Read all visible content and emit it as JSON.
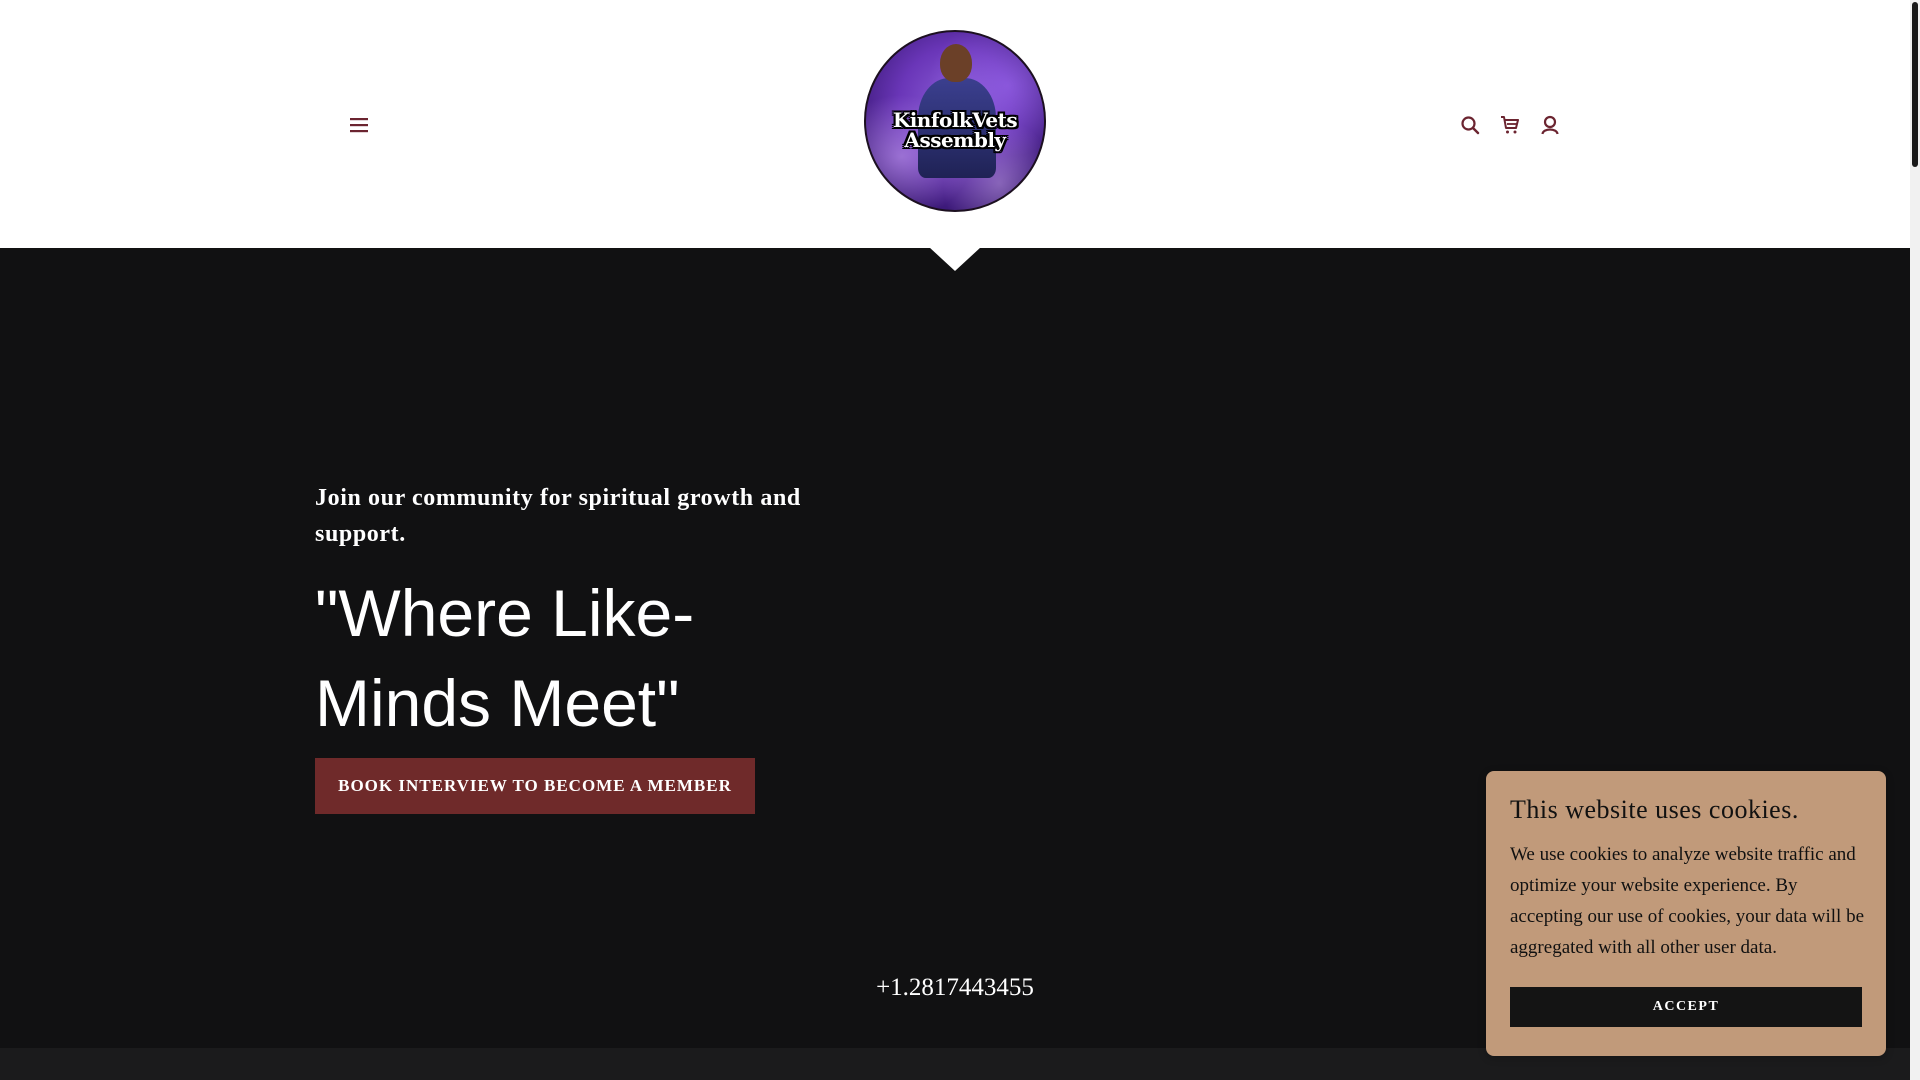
{
  "header": {
    "logo_text_line1": "KinfolkVets",
    "logo_text_line2": "Assembly",
    "menu_icon": "hamburger-menu-icon",
    "right_icons": [
      "search-icon",
      "cart-icon",
      "account-icon"
    ]
  },
  "hero": {
    "tagline": "Join our community for spiritual growth and support.",
    "headline_line1": "\"Where Like-",
    "headline_line2": "Minds Meet\"",
    "cta_label": "BOOK INTERVIEW TO BECOME A MEMBER",
    "phone": "+1.2817443455"
  },
  "cookie_banner": {
    "title": "This website uses cookies.",
    "body": "We use cookies to analyze website traffic and optimize your website experience. By accepting our use of cookies, your data will be aggregated with all other user data.",
    "accept_label": "ACCEPT"
  },
  "colors": {
    "accent": "#6f2a2a",
    "icon": "#6b2430",
    "hero_bg": "#111112",
    "cookie_bg": "#c19a7a"
  }
}
